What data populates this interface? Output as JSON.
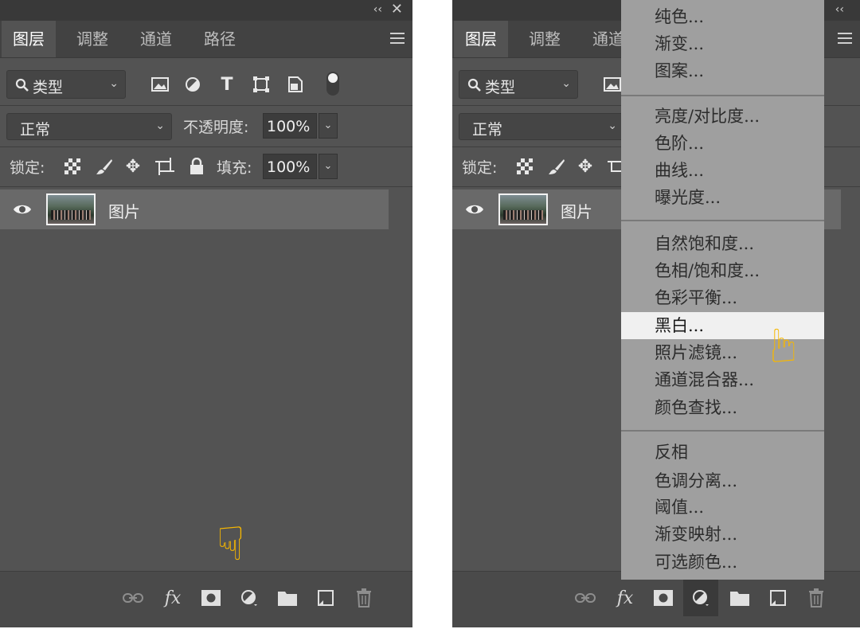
{
  "panel": {
    "tabs": [
      "图层",
      "调整",
      "通道",
      "路径"
    ],
    "filter": {
      "label": "类型"
    },
    "blend_mode": "正常",
    "opacity_label": "不透明度:",
    "opacity_value": "100%",
    "lock_label": "锁定:",
    "fill_label": "填充:",
    "fill_value": "100%",
    "layer": {
      "name": "图片"
    },
    "titlebar": {
      "collapse": "‹‹",
      "close": "✕"
    }
  },
  "right_panel": {
    "tabs_partial": [
      "图层",
      "调整",
      "通道"
    ],
    "blend_mode": "正常",
    "lock_label": "锁定:"
  },
  "adjust_menu": {
    "groups": [
      [
        "纯色...",
        "渐变...",
        "图案..."
      ],
      [
        "亮度/对比度...",
        "色阶...",
        "曲线...",
        "曝光度..."
      ],
      [
        "自然饱和度...",
        "色相/饱和度...",
        "色彩平衡...",
        "黑白...",
        "照片滤镜...",
        "通道混合器...",
        "颜色查找..."
      ],
      [
        "反相",
        "色调分离...",
        "阈值...",
        "渐变映射...",
        "可选颜色..."
      ]
    ],
    "highlighted": "黑白..."
  },
  "colors": {
    "panel_bg": "#535353",
    "hand": "#f7b700",
    "menu_bg": "#9f9f9f"
  },
  "icons": {
    "filter_icons": [
      "image-filter-icon",
      "adjustment-filter-icon",
      "type-filter-icon",
      "shape-filter-icon",
      "smart-object-filter-icon",
      "filter-toggle-icon"
    ],
    "lock_icons": [
      "lock-transparent-pixels-icon",
      "lock-image-pixels-icon",
      "lock-position-icon",
      "lock-artboard-icon",
      "lock-all-icon"
    ],
    "bottom_icons": [
      "link-layers-icon",
      "fx-icon",
      "add-mask-icon",
      "new-adjustment-layer-icon",
      "new-group-icon",
      "new-layer-icon",
      "delete-layer-icon"
    ]
  }
}
